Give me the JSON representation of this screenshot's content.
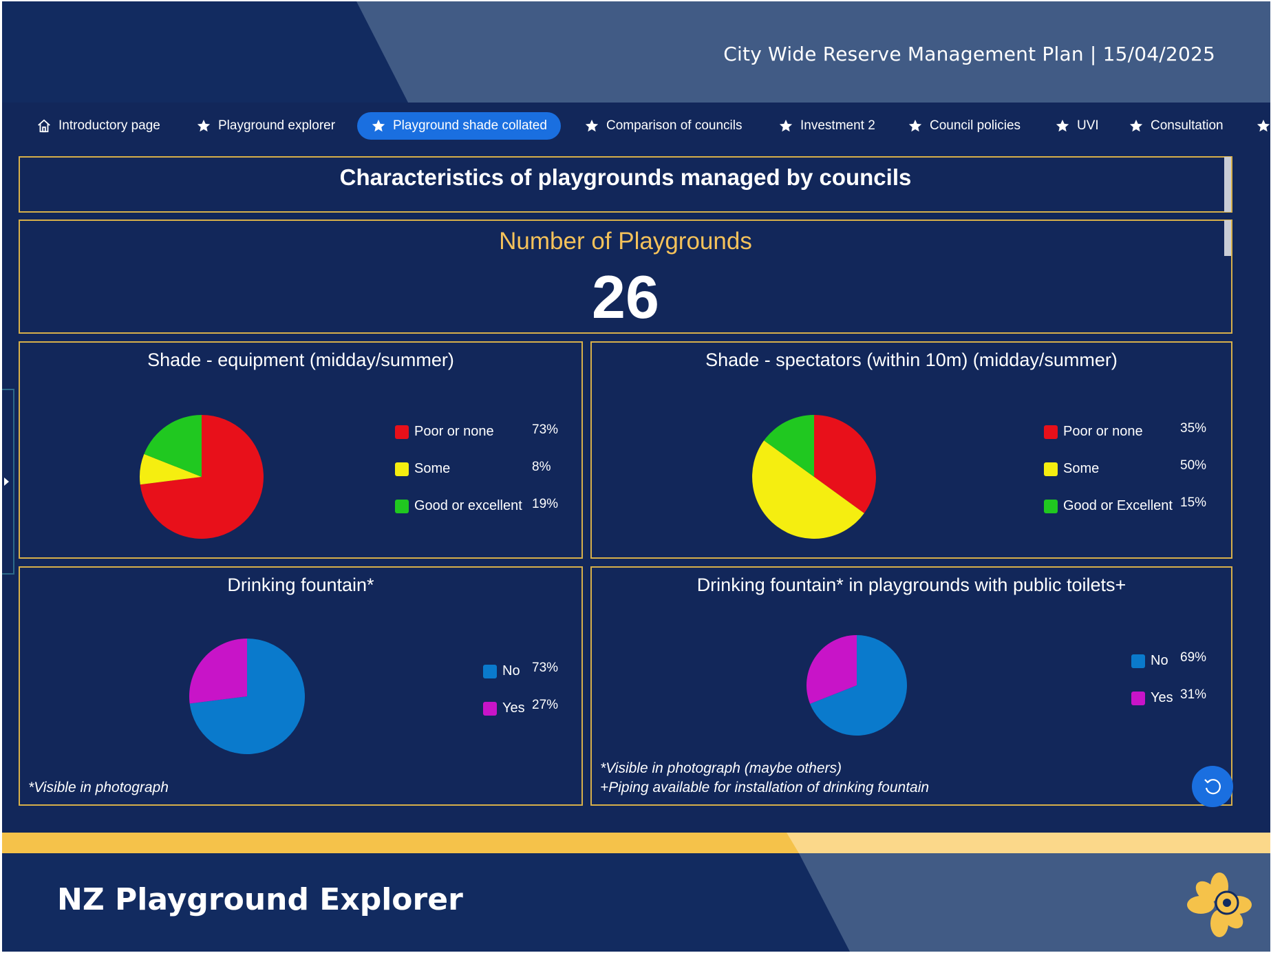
{
  "header": {
    "title": "City Wide Reserve Management Plan  |  15/04/2025"
  },
  "tabs": [
    {
      "label": "Introductory page",
      "icon": "home-icon",
      "active": false
    },
    {
      "label": "Playground explorer",
      "icon": "star-icon",
      "active": false
    },
    {
      "label": "Playground shade collated",
      "icon": "star-icon",
      "active": true
    },
    {
      "label": "Comparison of councils",
      "icon": "star-icon",
      "active": false
    },
    {
      "label": "Investment 2",
      "icon": "star-icon",
      "active": false
    },
    {
      "label": "Council policies",
      "icon": "star-icon",
      "active": false
    },
    {
      "label": "UVI",
      "icon": "star-icon",
      "active": false
    },
    {
      "label": "Consultation",
      "icon": "star-icon",
      "active": false
    }
  ],
  "main": {
    "heading": "Characteristics of playgrounds managed by councils",
    "count_label": "Number of Playgrounds",
    "count_value": "26"
  },
  "colors": {
    "background": "#12275a",
    "border": "#d8b04a",
    "accent": "#1a6fe0",
    "red": "#e8101a",
    "yellow": "#f5ee10",
    "green": "#20c820",
    "blue": "#0a7acc",
    "magenta": "#c814c8"
  },
  "charts": [
    {
      "title": "Shade - equipment (midday/summer)",
      "legend": [
        {
          "label": "Poor or none",
          "pct": "73%"
        },
        {
          "label": "Some",
          "pct": "8%"
        },
        {
          "label": "Good or excellent",
          "pct": "19%"
        }
      ]
    },
    {
      "title": "Shade - spectators (within 10m) (midday/summer)",
      "legend": [
        {
          "label": "Poor or none",
          "pct": "35%"
        },
        {
          "label": "Some",
          "pct": "50%"
        },
        {
          "label": "Good or Excellent",
          "pct": "15%"
        }
      ]
    },
    {
      "title": "Drinking fountain*",
      "legend": [
        {
          "label": "No",
          "pct": "73%"
        },
        {
          "label": "Yes",
          "pct": "27%"
        }
      ],
      "note": "*Visible in photograph"
    },
    {
      "title": "Drinking fountain* in playgrounds with public toilets+",
      "legend": [
        {
          "label": "No",
          "pct": "69%"
        },
        {
          "label": "Yes",
          "pct": "31%"
        }
      ],
      "note_line1": "*Visible in photograph (maybe others)",
      "note_line2": "+Piping available for installation of drinking fountain"
    }
  ],
  "chart_data": [
    {
      "type": "pie",
      "title": "Shade - equipment (midday/summer)",
      "categories": [
        "Poor or none",
        "Some",
        "Good or excellent"
      ],
      "values": [
        73,
        8,
        19
      ],
      "colors": [
        "#e8101a",
        "#f5ee10",
        "#20c820"
      ]
    },
    {
      "type": "pie",
      "title": "Shade - spectators (within 10m) (midday/summer)",
      "categories": [
        "Poor or none",
        "Some",
        "Good or Excellent"
      ],
      "values": [
        35,
        50,
        15
      ],
      "colors": [
        "#e8101a",
        "#f5ee10",
        "#20c820"
      ]
    },
    {
      "type": "pie",
      "title": "Drinking fountain*",
      "categories": [
        "No",
        "Yes"
      ],
      "values": [
        73,
        27
      ],
      "colors": [
        "#0a7acc",
        "#c814c8"
      ]
    },
    {
      "type": "pie",
      "title": "Drinking fountain* in playgrounds with public toilets+",
      "categories": [
        "No",
        "Yes"
      ],
      "values": [
        69,
        31
      ],
      "colors": [
        "#0a7acc",
        "#c814c8"
      ]
    }
  ],
  "footer": {
    "title": "NZ Playground Explorer",
    "logo": "flower-gear-logo"
  }
}
